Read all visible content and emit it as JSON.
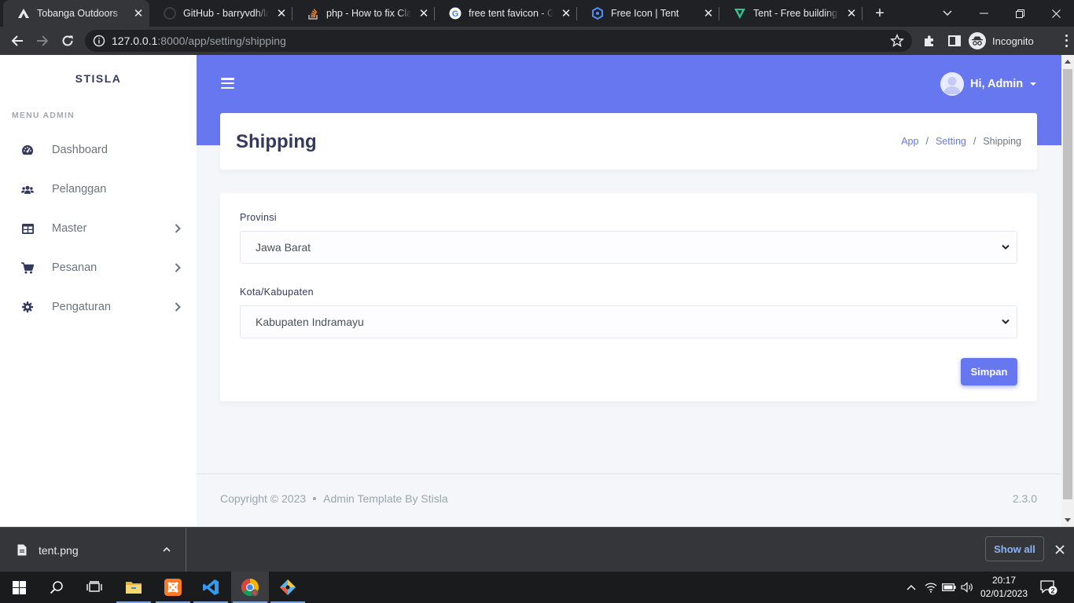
{
  "browser": {
    "tabs": [
      {
        "title": "Tobanga Outdoors",
        "active": true
      },
      {
        "title": "GitHub - barryvdh/laravel-dompdf",
        "active": false
      },
      {
        "title": "php - How to fix Class",
        "active": false
      },
      {
        "title": "free tent favicon - Google",
        "active": false
      },
      {
        "title": "Free Icon | Tent",
        "active": false
      },
      {
        "title": "Tent - Free buildings icons",
        "active": false
      }
    ],
    "url_host": "127.0.0.1",
    "url_rest": ":8000/app/setting/shipping",
    "profile_label": "Incognito"
  },
  "sidebar": {
    "brand": "STISLA",
    "menu_header": "MENU ADMIN",
    "items": [
      {
        "label": "Dashboard",
        "icon": "dashboard-icon",
        "has_children": false
      },
      {
        "label": "Pelanggan",
        "icon": "users-icon",
        "has_children": false
      },
      {
        "label": "Master",
        "icon": "table-icon",
        "has_children": true
      },
      {
        "label": "Pesanan",
        "icon": "cart-icon",
        "has_children": true
      },
      {
        "label": "Pengaturan",
        "icon": "gear-icon",
        "has_children": true
      }
    ]
  },
  "navbar": {
    "user_greeting": "Hi, Admin"
  },
  "section": {
    "title": "Shipping",
    "breadcrumb": [
      "App",
      "Setting",
      "Shipping"
    ]
  },
  "form": {
    "province_label": "Provinsi",
    "province_value": "Jawa Barat",
    "city_label": "Kota/Kabupaten",
    "city_value": "Kabupaten Indramayu",
    "submit_label": "Simpan"
  },
  "footer": {
    "copyright": "Copyright © 2023",
    "credit": "Admin Template By Stisla",
    "version": "2.3.0"
  },
  "downloads": {
    "file_name": "tent.png",
    "show_all_label": "Show all"
  },
  "taskbar": {
    "time": "20:17",
    "date": "02/01/2023",
    "notification_count": "2"
  },
  "colors": {
    "primary": "#6777ef",
    "page_bg": "#f4f6f9",
    "heading": "#34395e"
  }
}
